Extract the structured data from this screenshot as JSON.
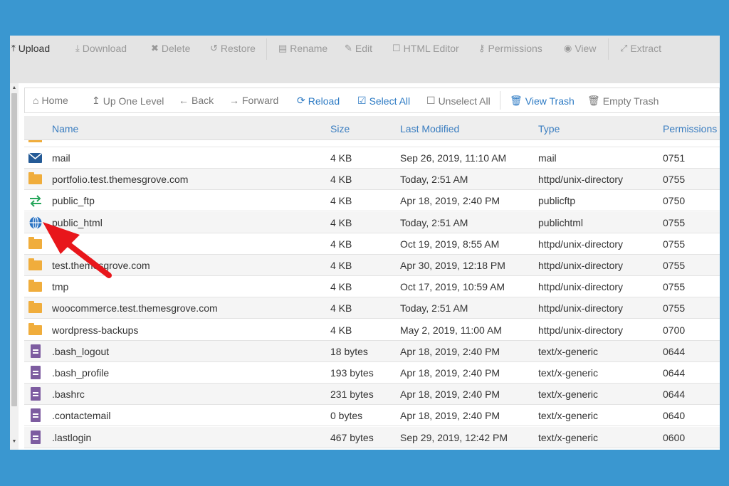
{
  "toolbar": {
    "upload": "Upload",
    "download": "Download",
    "delete": "Delete",
    "restore": "Restore",
    "rename": "Rename",
    "edit": "Edit",
    "html_editor": "HTML Editor",
    "permissions": "Permissions",
    "view": "View",
    "extract": "Extract"
  },
  "nav": {
    "home": "Home",
    "up_one_level": "Up One Level",
    "back": "Back",
    "forward": "Forward",
    "reload": "Reload",
    "select_all": "Select All",
    "unselect_all": "Unselect All",
    "view_trash": "View Trash",
    "empty_trash": "Empty Trash"
  },
  "table": {
    "headers": {
      "name": "Name",
      "size": "Size",
      "last_modified": "Last Modified",
      "type": "Type",
      "permissions": "Permissions"
    },
    "rows": [
      {
        "icon": "mail-icon",
        "name": "mail",
        "size": "4 KB",
        "modified": "Sep 26, 2019, 11:10 AM",
        "type": "mail",
        "perms": "0751"
      },
      {
        "icon": "folder-icon",
        "name": "portfolio.test.themesgrove.com",
        "size": "4 KB",
        "modified": "Today, 2:51 AM",
        "type": "httpd/unix-directory",
        "perms": "0755"
      },
      {
        "icon": "public-ftp-icon",
        "name": "public_ftp",
        "size": "4 KB",
        "modified": "Apr 18, 2019, 2:40 PM",
        "type": "publicftp",
        "perms": "0750"
      },
      {
        "icon": "globe-icon",
        "name": "public_html",
        "size": "4 KB",
        "modified": "Today, 2:51 AM",
        "type": "publichtml",
        "perms": "0755"
      },
      {
        "icon": "folder-icon",
        "name": "",
        "size": "4 KB",
        "modified": "Oct 19, 2019, 8:55 AM",
        "type": "httpd/unix-directory",
        "perms": "0755"
      },
      {
        "icon": "folder-icon",
        "name": "test.themesgrove.com",
        "size": "4 KB",
        "modified": "Apr 30, 2019, 12:18 PM",
        "type": "httpd/unix-directory",
        "perms": "0755"
      },
      {
        "icon": "folder-icon",
        "name": "tmp",
        "size": "4 KB",
        "modified": "Oct 17, 2019, 10:59 AM",
        "type": "httpd/unix-directory",
        "perms": "0755"
      },
      {
        "icon": "folder-icon",
        "name": "woocommerce.test.themesgrove.com",
        "size": "4 KB",
        "modified": "Today, 2:51 AM",
        "type": "httpd/unix-directory",
        "perms": "0755"
      },
      {
        "icon": "folder-icon",
        "name": "wordpress-backups",
        "size": "4 KB",
        "modified": "May 2, 2019, 11:00 AM",
        "type": "httpd/unix-directory",
        "perms": "0700"
      },
      {
        "icon": "file-icon",
        "name": ".bash_logout",
        "size": "18 bytes",
        "modified": "Apr 18, 2019, 2:40 PM",
        "type": "text/x-generic",
        "perms": "0644"
      },
      {
        "icon": "file-icon",
        "name": ".bash_profile",
        "size": "193 bytes",
        "modified": "Apr 18, 2019, 2:40 PM",
        "type": "text/x-generic",
        "perms": "0644"
      },
      {
        "icon": "file-icon",
        "name": ".bashrc",
        "size": "231 bytes",
        "modified": "Apr 18, 2019, 2:40 PM",
        "type": "text/x-generic",
        "perms": "0644"
      },
      {
        "icon": "file-icon",
        "name": ".contactemail",
        "size": "0 bytes",
        "modified": "Apr 18, 2019, 2:40 PM",
        "type": "text/x-generic",
        "perms": "0640"
      },
      {
        "icon": "file-icon",
        "name": ".lastlogin",
        "size": "467 bytes",
        "modified": "Sep 29, 2019, 12:42 PM",
        "type": "text/x-generic",
        "perms": "0600"
      }
    ]
  },
  "colors": {
    "background": "#3a97d0",
    "link": "#3a7dc0",
    "folder": "#f0ad3c",
    "arrow": "#e8161b"
  }
}
